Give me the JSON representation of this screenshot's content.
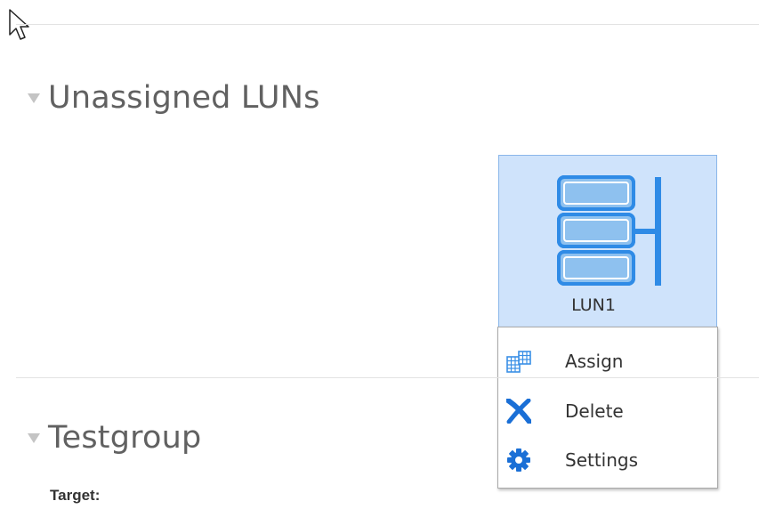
{
  "sections": {
    "unassigned": {
      "title": "Unassigned LUNs"
    },
    "testgroup": {
      "title": "Testgroup",
      "target_label": "Target:"
    }
  },
  "lun": {
    "label": "LUN1",
    "icon": "storage-lun-icon"
  },
  "context_menu": {
    "items": [
      {
        "label": "Assign",
        "icon": "assign-grid-icon"
      },
      {
        "label": "Delete",
        "icon": "delete-x-icon"
      },
      {
        "label": "Settings",
        "icon": "gear-icon"
      }
    ]
  },
  "colors": {
    "tile_background": "#cfe3fb",
    "tile_border": "#8ab6ea",
    "icon_blue": "#2f8be6",
    "disk_fill": "#8ec1ef",
    "text": "#333333",
    "title_text": "#616161"
  }
}
